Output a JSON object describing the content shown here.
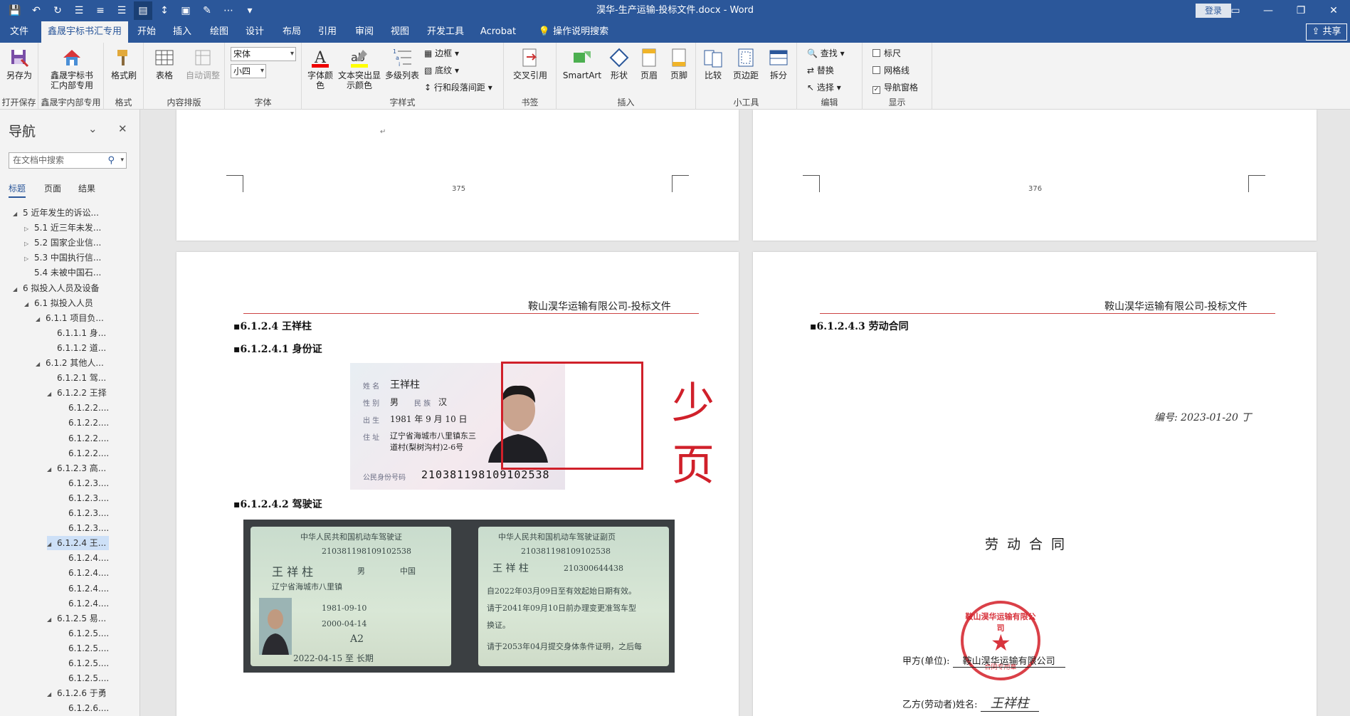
{
  "window": {
    "title": "淏华-生产运输-投标文件.docx  -  Word",
    "login": "登录",
    "share": "共享"
  },
  "tabs": [
    {
      "label": "文件"
    },
    {
      "label": "鑫晟宇标书汇专用"
    },
    {
      "label": "开始"
    },
    {
      "label": "插入"
    },
    {
      "label": "绘图"
    },
    {
      "label": "设计"
    },
    {
      "label": "布局"
    },
    {
      "label": "引用"
    },
    {
      "label": "审阅"
    },
    {
      "label": "视图"
    },
    {
      "label": "开发工具"
    },
    {
      "label": "Acrobat"
    },
    {
      "label": "操作说明搜索"
    }
  ],
  "ribbon": {
    "saveas": "另存为",
    "open_save": "打开保存",
    "xsy_line1": "鑫晟宇标书",
    "xsy_line2": "汇内部专用",
    "xsy_group": "鑫晟宇内部专用",
    "format_painter": "格式刷",
    "format_group": "格式",
    "table": "表格",
    "auto_adjust": "自动调整",
    "content_group": "内容排版",
    "font_name": "宋体",
    "font_size": "小四",
    "font_group": "字体",
    "font_color_1": "字体颜",
    "font_color_2": "色",
    "highlight_1": "文本突出显",
    "highlight_2": "示颜色",
    "multilevel": "多级列表",
    "border": "边框",
    "shading": "底纹",
    "spacing": "行和段落间距",
    "style_group": "字样式",
    "crossref": "交叉引用",
    "bookmark_group": "书签",
    "smartart": "SmartArt",
    "shape": "形状",
    "header": "页眉",
    "footer": "页脚",
    "insert_group": "插入",
    "compare": "比较",
    "margin": "页边距",
    "split": "拆分",
    "tools_group": "小工具",
    "find": "查找",
    "replace": "替换",
    "select": "选择",
    "edit_group": "编辑",
    "ruler": "标尺",
    "gridlines": "网格线",
    "navpane": "导航窗格",
    "show_group": "显示"
  },
  "nav": {
    "title": "导航",
    "search_placeholder": "在文档中搜索",
    "tabs": [
      "标题",
      "页面",
      "结果"
    ],
    "items": [
      {
        "text": "5 近年发生的诉讼..."
      },
      {
        "text": "5.1 近三年未发..."
      },
      {
        "text": "5.2 国家企业信..."
      },
      {
        "text": "5.3 中国执行信..."
      },
      {
        "text": "5.4 未被中国石..."
      },
      {
        "text": "6 拟投入人员及设备"
      },
      {
        "text": "6.1 拟投入人员"
      },
      {
        "text": "6.1.1 项目负..."
      },
      {
        "text": "6.1.1.1 身..."
      },
      {
        "text": "6.1.1.2 道..."
      },
      {
        "text": "6.1.2 其他人..."
      },
      {
        "text": "6.1.2.1 驾..."
      },
      {
        "text": "6.1.2.2 王择"
      },
      {
        "text": "6.1.2.2...."
      },
      {
        "text": "6.1.2.2...."
      },
      {
        "text": "6.1.2.2...."
      },
      {
        "text": "6.1.2.2...."
      },
      {
        "text": "6.1.2.3 高..."
      },
      {
        "text": "6.1.2.3...."
      },
      {
        "text": "6.1.2.3...."
      },
      {
        "text": "6.1.2.3...."
      },
      {
        "text": "6.1.2.3...."
      },
      {
        "text": "6.1.2.4 王..."
      },
      {
        "text": "6.1.2.4...."
      },
      {
        "text": "6.1.2.4...."
      },
      {
        "text": "6.1.2.4...."
      },
      {
        "text": "6.1.2.4...."
      },
      {
        "text": "6.1.2.5 易..."
      },
      {
        "text": "6.1.2.5...."
      },
      {
        "text": "6.1.2.5...."
      },
      {
        "text": "6.1.2.5...."
      },
      {
        "text": "6.1.2.5...."
      },
      {
        "text": "6.1.2.6 于勇"
      },
      {
        "text": "6.1.2.6...."
      }
    ]
  },
  "pages": {
    "num_left": "375",
    "num_right": "376",
    "header_text": "鞍山淏华运输有限公司-投标文件",
    "h_name": "6.1.2.4    王祥柱",
    "h_id": "6.1.2.4.1  身份证",
    "h_license": "6.1.2.4.2  驾驶证",
    "h_contract": "6.1.2.4.3  劳动合同",
    "annotation": "少页"
  },
  "idcard": {
    "l_name": "姓 名",
    "name": "王祥柱",
    "l_sex": "性 别",
    "sex": "男",
    "l_nation": "民 族",
    "nation": "汉",
    "l_birth": "出 生",
    "birth": "1981  年  9 月 10 日",
    "l_addr": "住 址",
    "addr1": "辽宁省海城市八里镇东三",
    "addr2": "道村(梨树沟村)2-6号",
    "l_idno": "公民身份号码",
    "idno": "210381198109102538"
  },
  "license": {
    "title_l": "中华人民共和国机动车驾驶证",
    "idno_l": "210381198109102538",
    "name": "王 祥 柱",
    "sex": "男",
    "country": "中国",
    "addr": "辽宁省海城市八里镇",
    "date1": "1981-09-10",
    "date2": "2000-04-14",
    "class": "A2",
    "valid": "2022-04-15 至 长期",
    "title_r": "中华人民共和国机动车驾驶证副页",
    "idno_r": "210381198109102538",
    "name_r": "王 祥 柱",
    "file_no": "210300644438",
    "note1": "自2022年03月09日至有效起始日期有效。",
    "note2": "请于2041年09月10日前办理变更准驾车型",
    "note3": "换证。",
    "note4": "请于2053年04月提交身体条件证明，之后每"
  },
  "contract": {
    "serial": "编号: 2023-01-20 丁",
    "title": "劳动合同",
    "party_a_label": "甲方(单位):",
    "party_a": "鞍山淏华运输有限公司",
    "party_b_label": "乙方(劳动者)姓名:",
    "party_b": "王祥柱",
    "stamp_top": "鞍山淏华运输有限公司",
    "stamp_bottom": "合同专用章"
  }
}
